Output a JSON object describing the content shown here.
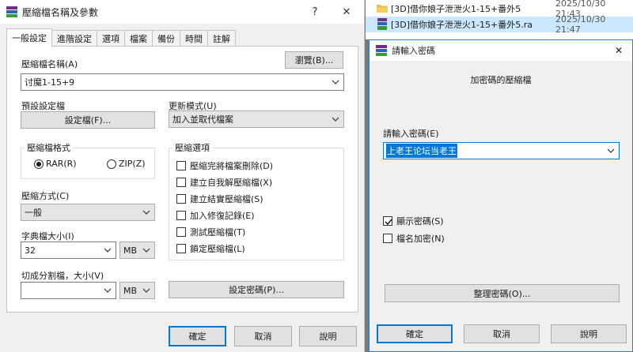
{
  "left_dialog": {
    "title": "壓縮檔名稱及參數",
    "help_btn": "?",
    "close_btn": "✕",
    "tabs": [
      "一般設定",
      "進階設定",
      "選項",
      "檔案",
      "備份",
      "時間",
      "註解"
    ],
    "archive_name_label": "壓縮檔名稱(A)",
    "archive_name_value": "讨魔1-15+9",
    "browse_button": "瀏覽(B)...",
    "default_profile_label": "預設設定檔",
    "profiles_button": "設定檔(F)...",
    "update_mode_label": "更新模式(U)",
    "update_mode_value": "加入並取代檔案",
    "format_group_title": "壓縮檔格式",
    "format_rar": "RAR(R)",
    "format_zip": "ZIP(Z)",
    "options_group_title": "壓縮選項",
    "options": [
      {
        "label": "壓縮完將檔案刪除(D)",
        "checked": false
      },
      {
        "label": "建立自我解壓縮檔(X)",
        "checked": false
      },
      {
        "label": "建立結實壓縮檔(S)",
        "checked": false
      },
      {
        "label": "加入修復記錄(E)",
        "checked": false
      },
      {
        "label": "測試壓縮檔(T)",
        "checked": false
      },
      {
        "label": "鎖定壓縮檔(L)",
        "checked": false
      }
    ],
    "method_label": "壓縮方式(C)",
    "method_value": "一般",
    "dict_label": "字典檔大小(I)",
    "dict_value": "32",
    "dict_unit": "MB",
    "split_label": "切成分割檔，大小(V)",
    "split_value": "",
    "split_unit": "MB",
    "set_password_button": "設定密碼(P)...",
    "ok_button": "確定",
    "cancel_button": "取消",
    "help_button": "說明"
  },
  "file_list": [
    {
      "name": "[3D]借你娘子泄泄火1-15+番外5",
      "date": "2025/10/30 21:43",
      "type": "folder",
      "selected": false
    },
    {
      "name": "[3D]借你娘子泄泄火1-15+番外5.ra",
      "date": "2025/10/30 21:47",
      "type": "rar",
      "selected": true
    }
  ],
  "password_dialog": {
    "title": "請輸入密碼",
    "close_btn": "✕",
    "heading": "加密碼的壓縮檔",
    "enter_label": "請輸入密碼(E)",
    "password_value": "上老王论坛当老王",
    "show_password_label": "顯示密碼(S)",
    "show_password_checked": true,
    "encrypt_names_label": "檔名加密(N)",
    "encrypt_names_checked": false,
    "organize_button": "整理密碼(O)...",
    "ok_button": "確定",
    "cancel_button": "取消",
    "help_button": "說明"
  },
  "colors": {
    "accent": "#0078d7",
    "selection": "#cce8ff",
    "dialog_bg": "#f0f0f0"
  }
}
